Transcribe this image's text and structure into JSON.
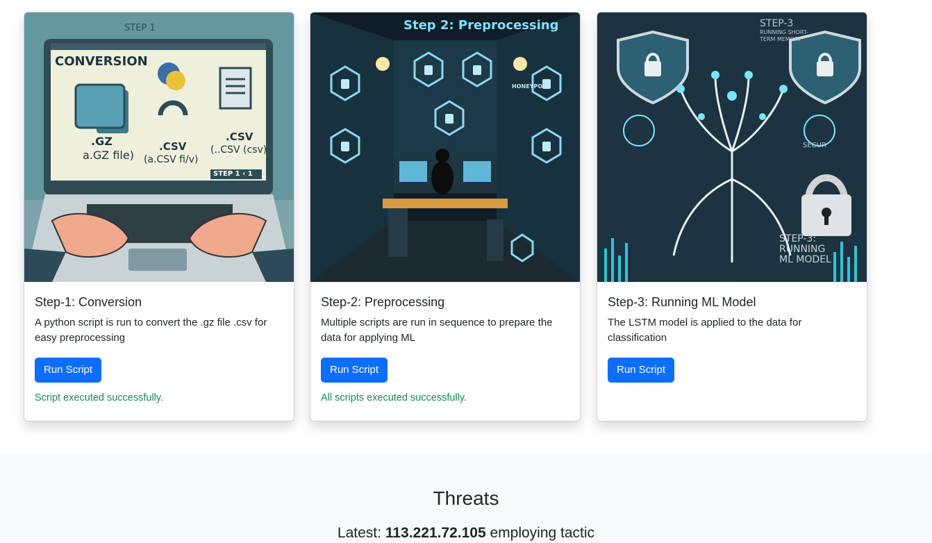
{
  "cards": [
    {
      "image": {
        "label_top": "STEP 1",
        "label_main": "CONVERSION",
        "gz_label": ".GZ",
        "gz_file": "a.GZ file)",
        "csv_mid": ".CSV",
        "csv_mid_sub": "(a.CSV fi/v)",
        "csv_right": ".CSV",
        "csv_right_sub": "(..CSV (csv)",
        "step_badge": "STEP 1 ‹ 1"
      },
      "title": "Step-1: Conversion",
      "description": "A python script is run to convert the .gz file .csv for easy preprocessing",
      "button_label": "Run Script",
      "status": "Script executed successfully."
    },
    {
      "image": {
        "label_main": "Step 2: Preprocessing",
        "honeypot": "HONEYPOT"
      },
      "title": "Step-2: Preprocessing",
      "description": "Multiple scripts are run in sequence to prepare the data for applying ML",
      "button_label": "Run Script",
      "status": "All scripts executed successfully."
    },
    {
      "image": {
        "label_top": "STEP-3",
        "label_sub": "RUNNING SHORT-TERM MEMORY",
        "label_bottom_1": "STEP-3:",
        "label_bottom_2": "RUNNING",
        "label_bottom_3": "ML MODEL",
        "secure": "SECUR"
      },
      "title": "Step-3: Running ML Model",
      "description": "The LSTM model is applied to the data for classification",
      "button_label": "Run Script",
      "status": ""
    }
  ],
  "threats": {
    "heading": "Threats",
    "latest_prefix": "Latest:",
    "latest_ip": "113.221.72.105",
    "latest_suffix": "employing tactic"
  },
  "colors": {
    "primary": "#0d6efd",
    "success": "#198754",
    "section_bg": "#f8f9fa"
  }
}
